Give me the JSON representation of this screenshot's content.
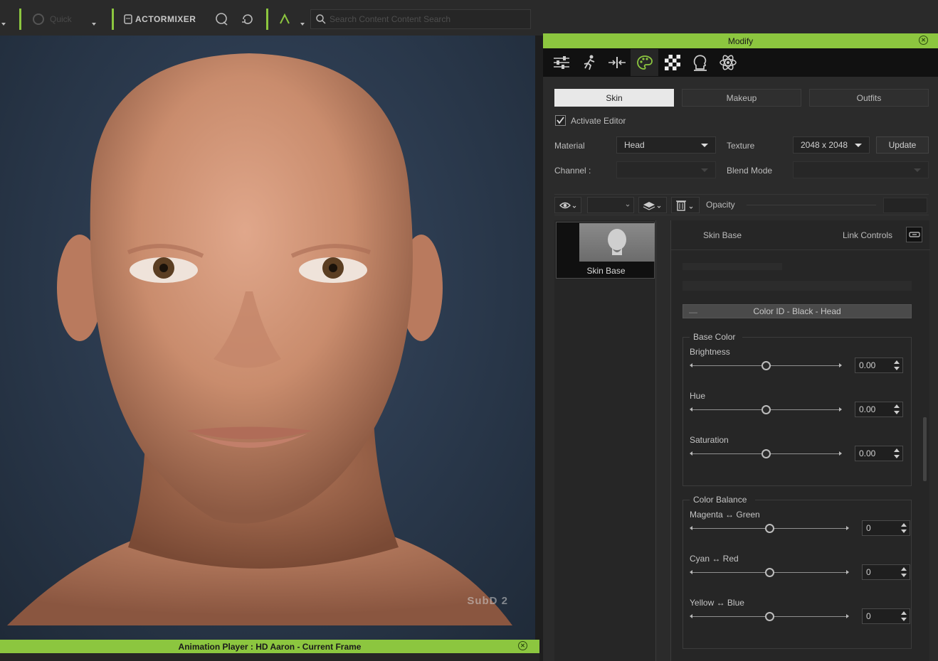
{
  "toolbar": {
    "left_item_label": "Quick",
    "actormixer_label": "ACTORMIXER",
    "search_placeholder": "Search Content Content Search"
  },
  "viewport": {
    "watermark": "SubD 2",
    "status_text": "Animation Player : HD Aaron - Current Frame"
  },
  "modify": {
    "title": "Modify",
    "icon_tabs": [
      "attribute-icon",
      "motion-icon",
      "edit-icon",
      "appearance-icon",
      "material-icon",
      "pose-icon",
      "physics-icon"
    ],
    "sub_tabs": [
      "Skin",
      "Makeup",
      "Outfits"
    ],
    "active_sub_tab": "Skin",
    "activate_editor_label": "Activate Editor",
    "activate_editor_checked": true,
    "material_label": "Material",
    "material_value": "Head",
    "texture_label": "Texture",
    "texture_value": "2048 x 2048",
    "update_label": "Update",
    "channel_label": "Channel :",
    "blend_mode_label": "Blend Mode",
    "opacity_label": "Opacity",
    "layer_name": "Skin Base",
    "props_title": "Skin Base",
    "link_controls_label": "Link Controls",
    "color_id_label": "Color ID - Black - Head",
    "base_color": {
      "title": "Base Color",
      "sliders": [
        {
          "label": "Brightness",
          "value": "0.00",
          "position": 0.5
        },
        {
          "label": "Hue",
          "value": "0.00",
          "position": 0.5
        },
        {
          "label": "Saturation",
          "value": "0.00",
          "position": 0.5
        }
      ]
    },
    "color_balance": {
      "title": "Color Balance",
      "sliders": [
        {
          "label": "Magenta ↔ Green",
          "value": "0",
          "position": 0.5
        },
        {
          "label": "Cyan ↔ Red",
          "value": "0",
          "position": 0.5
        },
        {
          "label": "Yellow ↔ Blue",
          "value": "0",
          "position": 0.5
        }
      ]
    }
  },
  "colors": {
    "accent": "#8cc63f",
    "panel_bg": "#2b2b2b",
    "viewport_bg": "#2c3b4f"
  }
}
